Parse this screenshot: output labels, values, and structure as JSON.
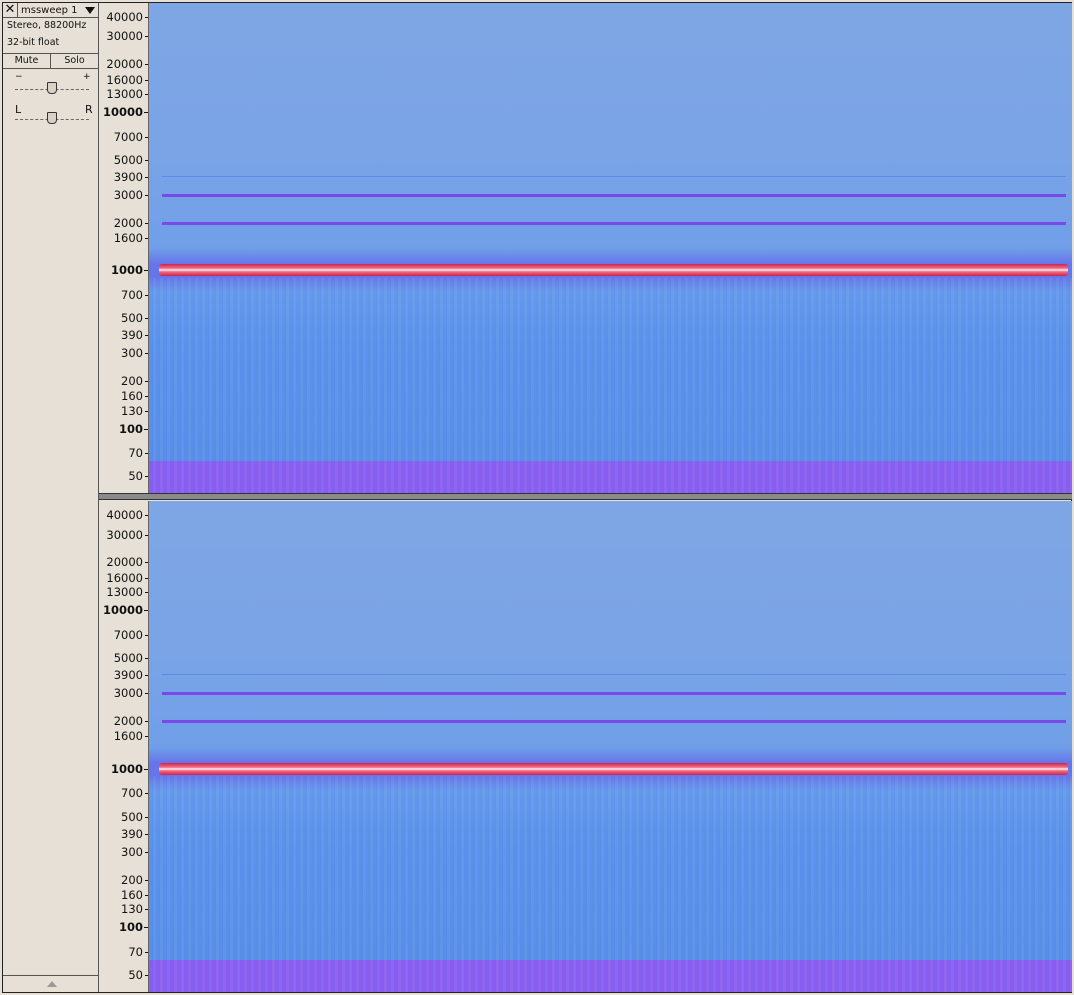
{
  "track": {
    "close_glyph": "✕",
    "name": "mssweep 1",
    "format_line1": "Stereo, 88200Hz",
    "format_line2": "32-bit float",
    "mute_label": "Mute",
    "solo_label": "Solo",
    "gain": {
      "minus": "−",
      "plus": "+",
      "value": 0.5
    },
    "pan": {
      "left": "L",
      "right": "R",
      "value": 0.5
    }
  },
  "channels": [
    {
      "ticks": [
        {
          "label": "40000",
          "major": false
        },
        {
          "label": "30000",
          "major": false
        },
        {
          "label": "20000",
          "major": false
        },
        {
          "label": "16000",
          "major": false
        },
        {
          "label": "13000",
          "major": false
        },
        {
          "label": "10000",
          "major": true
        },
        {
          "label": "7000",
          "major": false
        },
        {
          "label": "5000",
          "major": false
        },
        {
          "label": "3900",
          "major": false
        },
        {
          "label": "3000",
          "major": false
        },
        {
          "label": "2000",
          "major": false
        },
        {
          "label": "1600",
          "major": false
        },
        {
          "label": "1000",
          "major": true
        },
        {
          "label": "700",
          "major": false
        },
        {
          "label": "500",
          "major": false
        },
        {
          "label": "390",
          "major": false
        },
        {
          "label": "300",
          "major": false
        },
        {
          "label": "200",
          "major": false
        },
        {
          "label": "160",
          "major": false
        },
        {
          "label": "130",
          "major": false
        },
        {
          "label": "100",
          "major": true
        },
        {
          "label": "70",
          "major": false
        },
        {
          "label": "50",
          "major": false
        }
      ]
    },
    {
      "ticks": [
        {
          "label": "40000",
          "major": false
        },
        {
          "label": "30000",
          "major": false
        },
        {
          "label": "20000",
          "major": false
        },
        {
          "label": "16000",
          "major": false
        },
        {
          "label": "13000",
          "major": false
        },
        {
          "label": "10000",
          "major": true
        },
        {
          "label": "7000",
          "major": false
        },
        {
          "label": "5000",
          "major": false
        },
        {
          "label": "3900",
          "major": false
        },
        {
          "label": "3000",
          "major": false
        },
        {
          "label": "2000",
          "major": false
        },
        {
          "label": "1600",
          "major": false
        },
        {
          "label": "1000",
          "major": true
        },
        {
          "label": "700",
          "major": false
        },
        {
          "label": "500",
          "major": false
        },
        {
          "label": "390",
          "major": false
        },
        {
          "label": "300",
          "major": false
        },
        {
          "label": "200",
          "major": false
        },
        {
          "label": "160",
          "major": false
        },
        {
          "label": "130",
          "major": false
        },
        {
          "label": "100",
          "major": true
        },
        {
          "label": "70",
          "major": false
        },
        {
          "label": "50",
          "major": false
        }
      ]
    }
  ],
  "spectrogram": {
    "tone_hz": 1000,
    "harmonics_hz": [
      2000,
      3000,
      3900
    ],
    "colors": {
      "background": "#7aa4e6",
      "tone_core": "#fff0f0",
      "tone_edge": "#d0224a",
      "harmonic": "#7a4ae8",
      "low_band": "#8a5cf0"
    }
  }
}
